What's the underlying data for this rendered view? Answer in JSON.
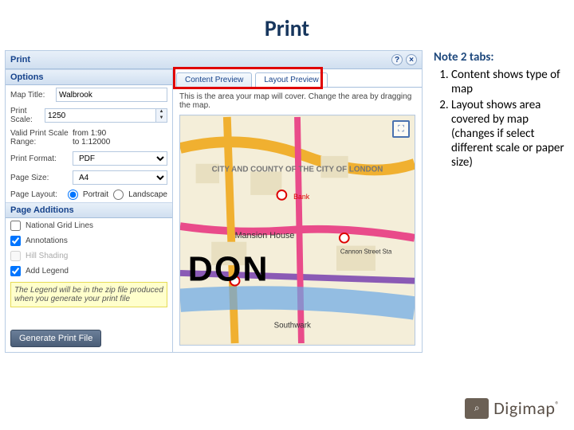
{
  "slide": {
    "title": "Print"
  },
  "app": {
    "header": {
      "title": "Print",
      "help_icon": "?",
      "close_icon": "×"
    },
    "options": {
      "section_label": "Options",
      "map_title_label": "Map Title:",
      "map_title_value": "Walbrook",
      "print_scale_label": "Print Scale:",
      "print_scale_value": "1250",
      "valid_range_label": "Valid Print Scale Range:",
      "valid_range_value": "from 1:90\nto 1:12000",
      "print_format_label": "Print Format:",
      "print_format_value": "PDF",
      "page_size_label": "Page Size:",
      "page_size_value": "A4",
      "page_layout_label": "Page Layout:",
      "layout_portrait": "Portrait",
      "layout_landscape": "Landscape"
    },
    "additions": {
      "section_label": "Page Additions",
      "grid_label": "National Grid Lines",
      "annotations_label": "Annotations",
      "hill_label": "Hill Shading",
      "legend_label": "Add Legend",
      "legend_note": "The Legend will be in the zip file produced when you generate your print file"
    },
    "generate_button": "Generate Print File",
    "preview": {
      "tab_content": "Content Preview",
      "tab_layout": "Layout Preview",
      "area_note": "This is the area your map will cover. Change the area by dragging the map.",
      "map_labels": {
        "city": "CITY AND COUNTY OF THE CITY OF LONDON",
        "mansion": "Mansion House",
        "london": "DON",
        "southwark": "Southwark",
        "bank": "Bank",
        "cannon": "Cannon Street Sta"
      }
    }
  },
  "annotation": {
    "title": "Note 2 tabs:",
    "items": [
      "Content shows type of map",
      "Layout shows area covered by map (changes if select different scale or paper size)"
    ]
  },
  "logo": {
    "badge": "⌕",
    "text": "Digimap",
    "reg": "®"
  }
}
